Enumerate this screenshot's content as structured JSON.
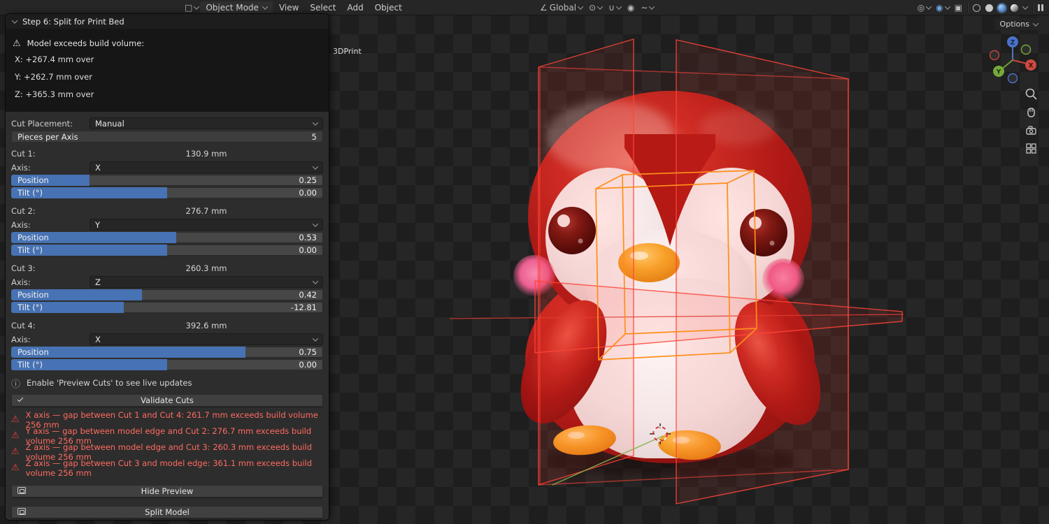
{
  "viewport": {
    "header": {
      "mode": "Object Mode",
      "menus": [
        "View",
        "Select",
        "Add",
        "Object"
      ],
      "orientation": "Global",
      "options": "Options"
    },
    "scene_label": "3DPrint",
    "gizmo_axes": {
      "x": "X",
      "y": "Y",
      "z": "Z"
    }
  },
  "panel": {
    "title": "Step 6: Split for Print Bed",
    "warning_title": "Model exceeds build volume:",
    "warning_lines": [
      "X: +267.4 mm over",
      "Y: +262.7 mm over",
      "Z: +365.3 mm over"
    ],
    "cut_placement_label": "Cut Placement:",
    "cut_placement_value": "Manual",
    "pieces_label": "Pieces per Axis",
    "pieces_value": "5",
    "axis_label": "Axis:",
    "position_label": "Position",
    "tilt_label": "Tilt (°)",
    "cuts": [
      {
        "label": "Cut 1:",
        "size": "130.9 mm",
        "axis": "X",
        "position": "0.25",
        "position_pct": 25,
        "tilt": "0.00",
        "tilt_pct": 50
      },
      {
        "label": "Cut 2:",
        "size": "276.7 mm",
        "axis": "Y",
        "position": "0.53",
        "position_pct": 53,
        "tilt": "0.00",
        "tilt_pct": 50
      },
      {
        "label": "Cut 3:",
        "size": "260.3 mm",
        "axis": "Z",
        "position": "0.42",
        "position_pct": 42,
        "tilt": "-12.81",
        "tilt_pct": 36
      },
      {
        "label": "Cut 4:",
        "size": "392.6 mm",
        "axis": "X",
        "position": "0.75",
        "position_pct": 75,
        "tilt": "0.00",
        "tilt_pct": 50
      }
    ],
    "info_text": "Enable 'Preview Cuts' to see live updates",
    "validate_label": "Validate Cuts",
    "errors": [
      "X axis — gap between Cut 1 and Cut 4: 261.7 mm exceeds build volume 256 mm",
      "Y axis — gap between model edge and Cut 2: 276.7 mm exceeds build volume 256 mm",
      "Z axis — gap between model edge and Cut 3: 260.3 mm exceeds build volume 256 mm",
      "Z axis — gap between Cut 3 and model edge: 361.1 mm exceeds build volume 256 mm"
    ],
    "hide_preview_label": "Hide Preview",
    "split_model_label": "Split Model"
  },
  "icons": {
    "warning": "⚠",
    "error": "⚠",
    "info": "ⓘ"
  },
  "colors": {
    "slider_fill": "#4772b3",
    "error_text": "#ff6b60",
    "cut_plane_red": "#ff4438",
    "bounding_box_orange": "#ff8e1a"
  }
}
